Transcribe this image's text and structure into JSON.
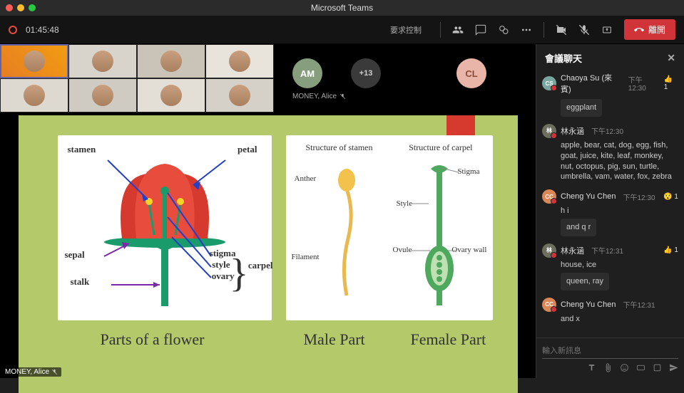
{
  "app": {
    "title": "Microsoft Teams"
  },
  "toolbar": {
    "timer": "01:45:48",
    "request_label": "要求控制",
    "leave_label": "離開"
  },
  "bubbles": {
    "am": "AM",
    "plus": "+13",
    "cl": "CL",
    "presenter_name": "MONEY, Alice"
  },
  "nametag": "MONEY, Alice",
  "slide": {
    "caption1": "Parts of a flower",
    "caption2": "Male Part",
    "caption3": "Female Part",
    "card1": {
      "stamen": "stamen",
      "petal": "petal",
      "sepal": "sepal",
      "stalk": "stalk",
      "stigma": "stigma",
      "style": "style",
      "ovary": "ovary",
      "carpel": "carpel"
    },
    "card2": {
      "h1": "Structure of stamen",
      "h2": "Structure of carpel",
      "anther": "Anther",
      "filament": "Filament",
      "stigma": "Stigma",
      "style": "Style",
      "ovule": "Ovule",
      "ovarywall": "Ovary wall"
    }
  },
  "chat": {
    "title": "會議聊天",
    "input_placeholder": "輸入新訊息",
    "messages": [
      {
        "avatar": "CS",
        "color": "#7aa6a0",
        "name": "Chaoya Su (來賓)",
        "time": "下午12:30",
        "body": "eggplant",
        "react": {
          "icon": "👍",
          "count": 1
        },
        "bubble": true
      },
      {
        "avatar": "林",
        "color": "#6e6e5e",
        "name": "林永涵",
        "time": "下午12:30",
        "body": "apple, bear, cat, dog, egg, fish, goat, juice, kite, leaf, monkey, nut, octopus, pig, sun, turtle, umbrella, vam, water, fox, zebra"
      },
      {
        "avatar": "CC",
        "color": "#d98757",
        "name": "Cheng Yu Chen",
        "time": "下午12:30",
        "body": "h i",
        "react": {
          "icon": "😯",
          "count": 1
        },
        "extra_bubble": "and q r"
      },
      {
        "avatar": "林",
        "color": "#6e6e5e",
        "name": "林永涵",
        "time": "下午12:31",
        "body": "house, ice",
        "react": {
          "icon": "👍",
          "count": 1
        },
        "extra_bubble": "queen, ray"
      },
      {
        "avatar": "CC",
        "color": "#d98757",
        "name": "Cheng Yu Chen",
        "time": "下午12:31",
        "body": "and x"
      }
    ]
  }
}
